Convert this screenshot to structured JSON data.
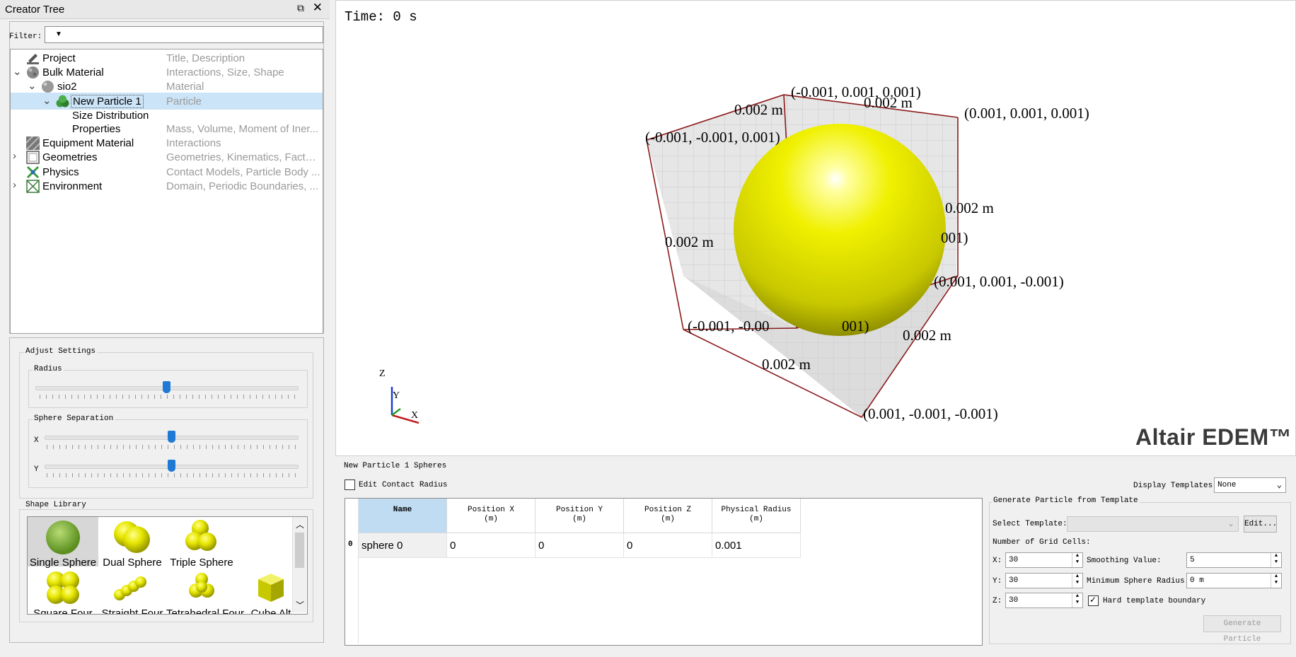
{
  "dock": {
    "title": "Creator Tree"
  },
  "filter": {
    "label": "Filter:",
    "value": ""
  },
  "tree": [
    {
      "name": "Project",
      "desc": "Title, Description"
    },
    {
      "name": "Bulk Material",
      "desc": "Interactions, Size, Shape"
    },
    {
      "name": "sio2",
      "desc": "Material"
    },
    {
      "name": "New Particle 1",
      "desc": "Particle"
    },
    {
      "name": "Size Distribution",
      "desc": ""
    },
    {
      "name": "Properties",
      "desc": "Mass, Volume, Moment of Iner..."
    },
    {
      "name": "Equipment Material",
      "desc": "Interactions"
    },
    {
      "name": "Geometries",
      "desc": "Geometries, Kinematics, Factor..."
    },
    {
      "name": "Physics",
      "desc": "Contact Models, Particle Body ..."
    },
    {
      "name": "Environment",
      "desc": "Domain, Periodic Boundaries, ..."
    }
  ],
  "adjust": {
    "title": "Adjust Settings",
    "radius_label": "Radius",
    "radius_level": 0.5,
    "sep_label": "Sphere Separation",
    "x_label": "X",
    "y_label": "Y",
    "x_level": 0.5,
    "y_level": 0.5
  },
  "shape_library": {
    "title": "Shape Library",
    "items": [
      "Single Sphere",
      "Dual Sphere",
      "Triple Sphere",
      "Square Four",
      "Straight Four",
      "Tetrahedral Four",
      "Cube Alt"
    ]
  },
  "viewport": {
    "time": "Time: 0 s",
    "brand": "Altair EDEM™",
    "labels": [
      "(-0.001, 0.001, 0.001)",
      "0.002 m",
      "(0.001, 0.001, 0.001)",
      "(-0.001, -0.001, 0.001)",
      "0.002 m",
      "0.002 m",
      "001)",
      "(0.001, 0.001, -0.001)",
      "(-0.001, -0.00",
      "001)",
      "0.002 m",
      "0.002 m",
      "(0.001, -0.001, -0.001)",
      "0.002 m"
    ],
    "axes": {
      "z": "Z",
      "y": "Y",
      "x": "X"
    }
  },
  "spheres_panel": {
    "title": "New Particle 1 Spheres",
    "edit_contact_radius": "Edit Contact Radius",
    "display_templates_label": "Display Templates:",
    "display_templates_value": "None",
    "columns": [
      {
        "h1": "Name",
        "h2": ""
      },
      {
        "h1": "Position X",
        "h2": "(m)"
      },
      {
        "h1": "Position Y",
        "h2": "(m)"
      },
      {
        "h1": "Position Z",
        "h2": "(m)"
      },
      {
        "h1": "Physical Radius",
        "h2": "(m)"
      }
    ],
    "rows": [
      {
        "index": "0",
        "name": "sphere 0",
        "x": "0",
        "y": "0",
        "z": "0",
        "r": "0.001"
      }
    ]
  },
  "generate": {
    "title": "Generate Particle from Template",
    "select_template": "Select Template:",
    "edit_btn": "Edit...",
    "grid_cells": "Number of Grid Cells:",
    "x_label": "X:",
    "x_value": "30",
    "y_label": "Y:",
    "y_value": "30",
    "z_label": "Z:",
    "z_value": "30",
    "smoothing_label": "Smoothing Value:",
    "smoothing_value": "5",
    "min_radius_label": "Minimum Sphere Radius:",
    "min_radius_value": "0 m",
    "hard_boundary": "Hard template boundary",
    "generate_btn": "Generate Particle"
  },
  "colors": {
    "selection": "#cce4f7",
    "slider": "#1e7ad4",
    "particle": "#e6e600"
  }
}
